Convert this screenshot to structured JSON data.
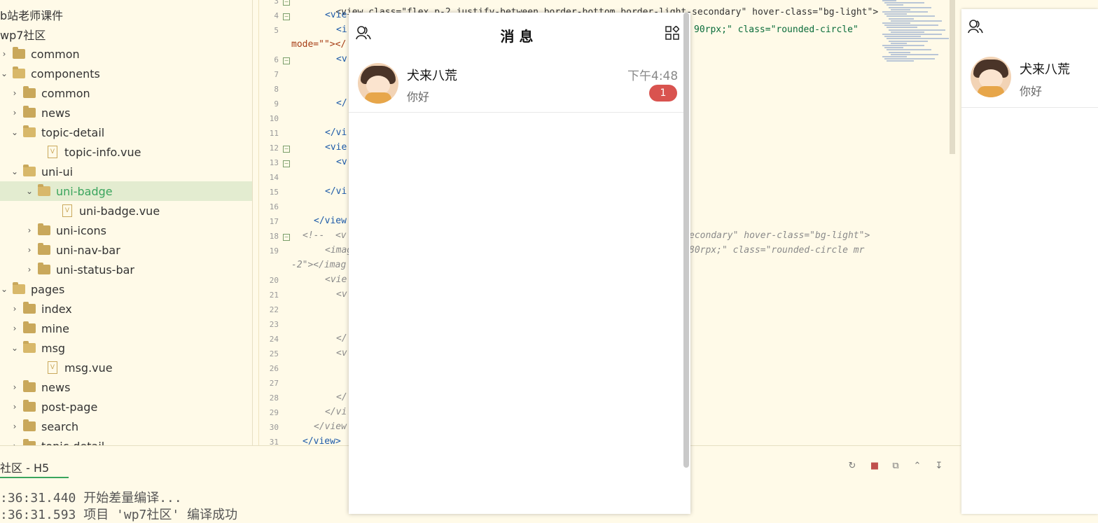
{
  "sidebar": {
    "items": [
      {
        "label": "b站老师课件",
        "indent": 0,
        "kind": "none"
      },
      {
        "label": "wp7社区",
        "indent": 0,
        "kind": "none"
      },
      {
        "label": "common",
        "indent": 0,
        "kind": "folder-closed"
      },
      {
        "label": "components",
        "indent": 0,
        "kind": "folder-open"
      },
      {
        "label": "common",
        "indent": 1,
        "kind": "folder-closed"
      },
      {
        "label": "news",
        "indent": 1,
        "kind": "folder-closed"
      },
      {
        "label": "topic-detail",
        "indent": 1,
        "kind": "folder-open"
      },
      {
        "label": "topic-info.vue",
        "indent": 2,
        "kind": "vue"
      },
      {
        "label": "uni-ui",
        "indent": 1,
        "kind": "folder-open"
      },
      {
        "label": "uni-badge",
        "indent": 2,
        "kind": "folder-open",
        "selected": true
      },
      {
        "label": "uni-badge.vue",
        "indent": 3,
        "kind": "vue"
      },
      {
        "label": "uni-icons",
        "indent": 2,
        "kind": "folder-closed"
      },
      {
        "label": "uni-nav-bar",
        "indent": 2,
        "kind": "folder-closed"
      },
      {
        "label": "uni-status-bar",
        "indent": 2,
        "kind": "folder-closed"
      },
      {
        "label": "pages",
        "indent": 0,
        "kind": "folder-open"
      },
      {
        "label": "index",
        "indent": 1,
        "kind": "folder-closed"
      },
      {
        "label": "mine",
        "indent": 1,
        "kind": "folder-closed"
      },
      {
        "label": "msg",
        "indent": 1,
        "kind": "folder-open"
      },
      {
        "label": "msg.vue",
        "indent": 2,
        "kind": "vue"
      },
      {
        "label": "news",
        "indent": 1,
        "kind": "folder-closed"
      },
      {
        "label": "post-page",
        "indent": 1,
        "kind": "folder-closed"
      },
      {
        "label": "search",
        "indent": 1,
        "kind": "folder-closed"
      },
      {
        "label": "topic-detail",
        "indent": 1,
        "kind": "folder-closed"
      }
    ]
  },
  "editor": {
    "line_numbers": [
      "3",
      "4",
      "5",
      "",
      "6",
      "7",
      "8",
      "9",
      "10",
      "11",
      "12",
      "13",
      "14",
      "15",
      "16",
      "17",
      "18",
      "19",
      "",
      "20",
      "21",
      "22",
      "23",
      "24",
      "25",
      "26",
      "27",
      "28",
      "29",
      "30",
      "31"
    ],
    "line1": "<view class=\"flex p-2 justify-between border-bottom border-light-secondary\" hover-class=\"bg-light\">",
    "line4_tail": "90rpx;\" class=\"rounded-circle\"",
    "line5": "mode=\"\"></",
    "line18_tail": "econdary\" hover-class=\"bg-light\">",
    "line18_head": "<!--  <v",
    "line19_tail": "80rpx;\" class=\"rounded-circle mr",
    "line19_head": "<imag",
    "line19b": "-2\"></imag",
    "frag_view_open": "<vie",
    "frag_v": "<v",
    "frag_i": "<i",
    "frag_close_vi": "</vi",
    "frag_close_view": "</view",
    "frag_close": "</",
    "frag_vie": "<vie",
    "frag_close_view_end": "</view>"
  },
  "console": {
    "tab_label": "社区 - H5",
    "lines": [
      ":36:31.440 开始差量编译...",
      ":36:31.593 项目 'wp7社区' 编译成功"
    ]
  },
  "phone": {
    "title": "消 息",
    "messages": [
      {
        "name": "犬来八荒",
        "text": "你好",
        "time": "下午4:48",
        "badge": "1"
      }
    ]
  },
  "phone2": {
    "messages": [
      {
        "name": "犬来八荒",
        "text": "你好"
      }
    ]
  }
}
